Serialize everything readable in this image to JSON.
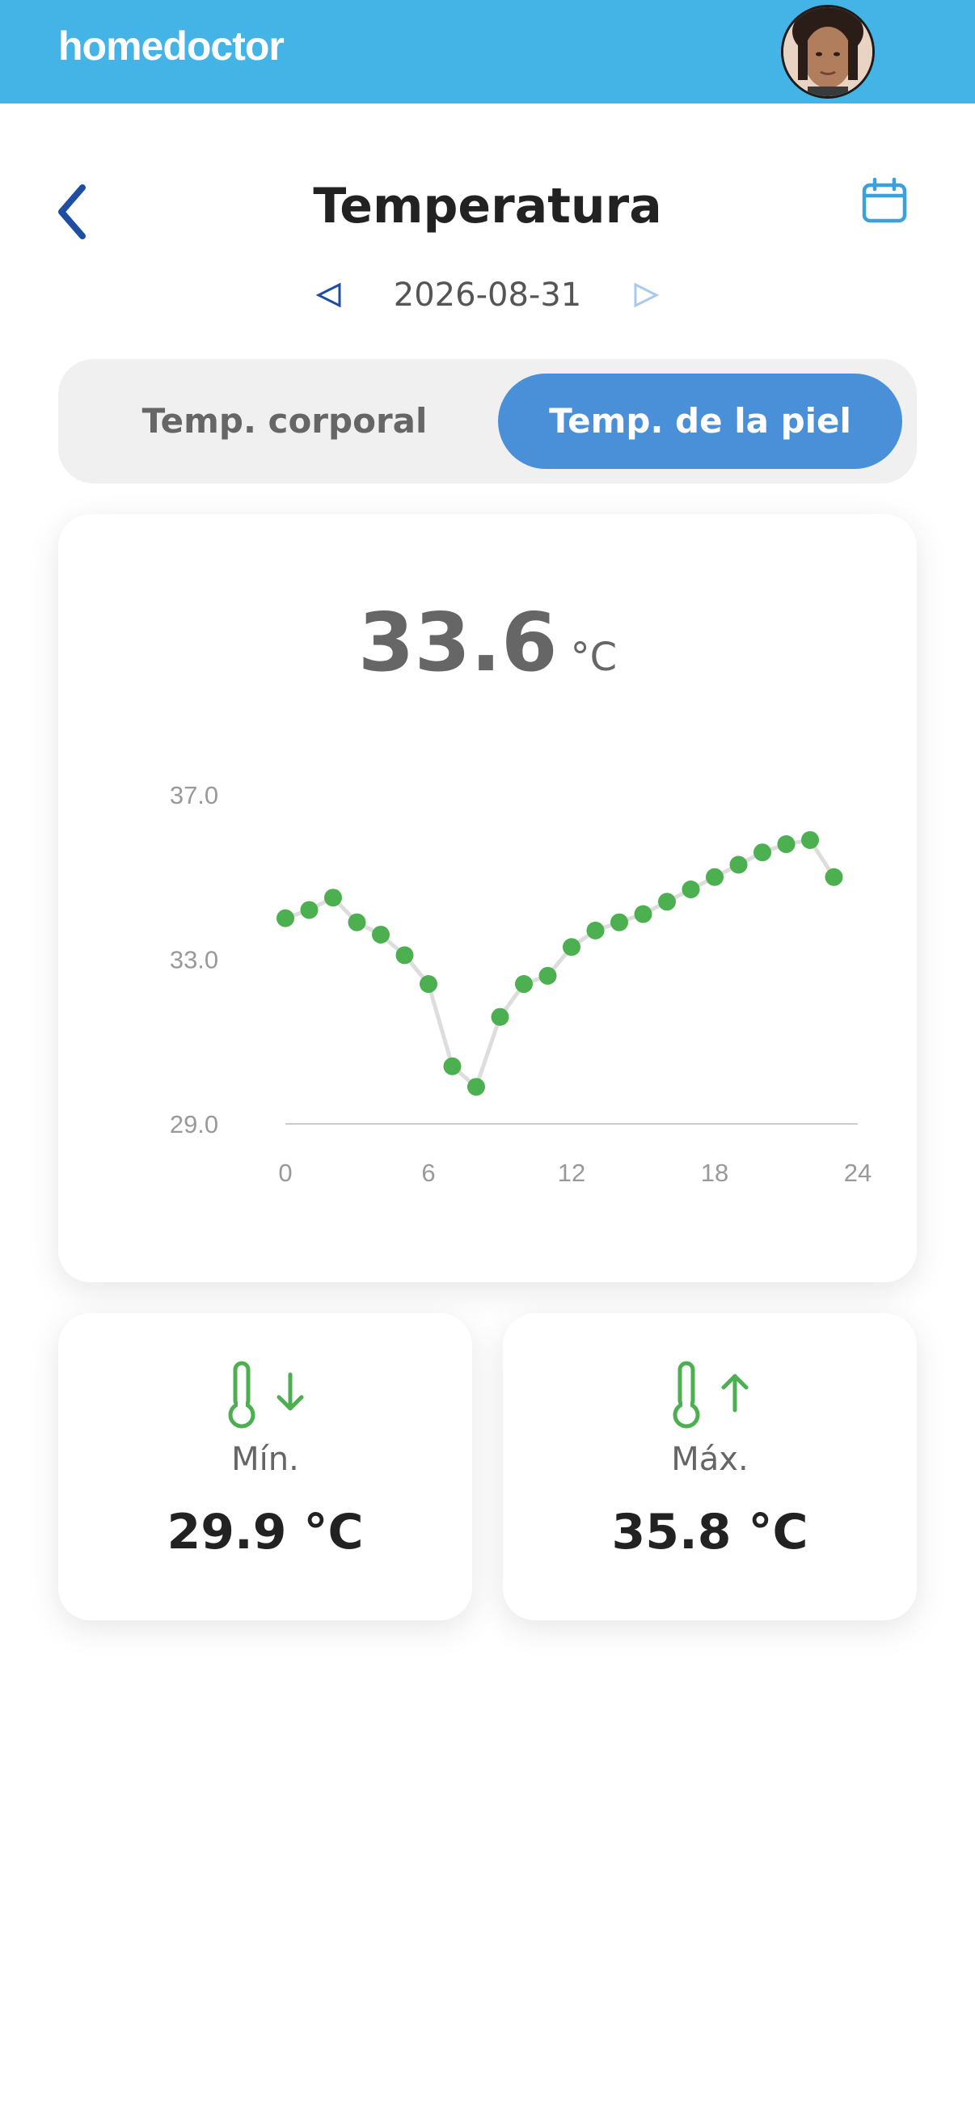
{
  "header": {
    "logo": "homedoctor"
  },
  "page": {
    "title": "Temperatura",
    "date": "2026-08-31"
  },
  "tabs": [
    {
      "label": "Temp. corporal",
      "active": false
    },
    {
      "label": "Temp. de la piel",
      "active": true
    }
  ],
  "summary": {
    "value": "33.6",
    "unit": "°C"
  },
  "chart_data": {
    "type": "line",
    "x": [
      0,
      1,
      2,
      3,
      4,
      5,
      6,
      7,
      8,
      9,
      10,
      11,
      12,
      13,
      14,
      15,
      16,
      17,
      18,
      19,
      20,
      21,
      22,
      23
    ],
    "values": [
      34.0,
      34.2,
      34.5,
      33.9,
      33.6,
      33.1,
      32.4,
      30.4,
      29.9,
      31.6,
      32.4,
      32.6,
      33.3,
      33.7,
      33.9,
      34.1,
      34.4,
      34.7,
      35.0,
      35.3,
      35.6,
      35.8,
      35.9,
      35.0
    ],
    "ylim": [
      29.0,
      37.0
    ],
    "yticks": [
      "37.0",
      "33.0",
      "29.0"
    ],
    "xticks": [
      "0",
      "6",
      "12",
      "18",
      "24"
    ],
    "xlim": [
      0,
      24
    ],
    "point_color": "#4caf50",
    "line_color": "#dddddd"
  },
  "stats": {
    "min": {
      "label": "Mín.",
      "value": "29.9 °C",
      "icon": "thermometer-down-icon"
    },
    "max": {
      "label": "Máx.",
      "value": "35.8 °C",
      "icon": "thermometer-up-icon"
    }
  },
  "colors": {
    "header": "#44b3e6",
    "accent": "#4a90d9",
    "green": "#4caf50"
  }
}
